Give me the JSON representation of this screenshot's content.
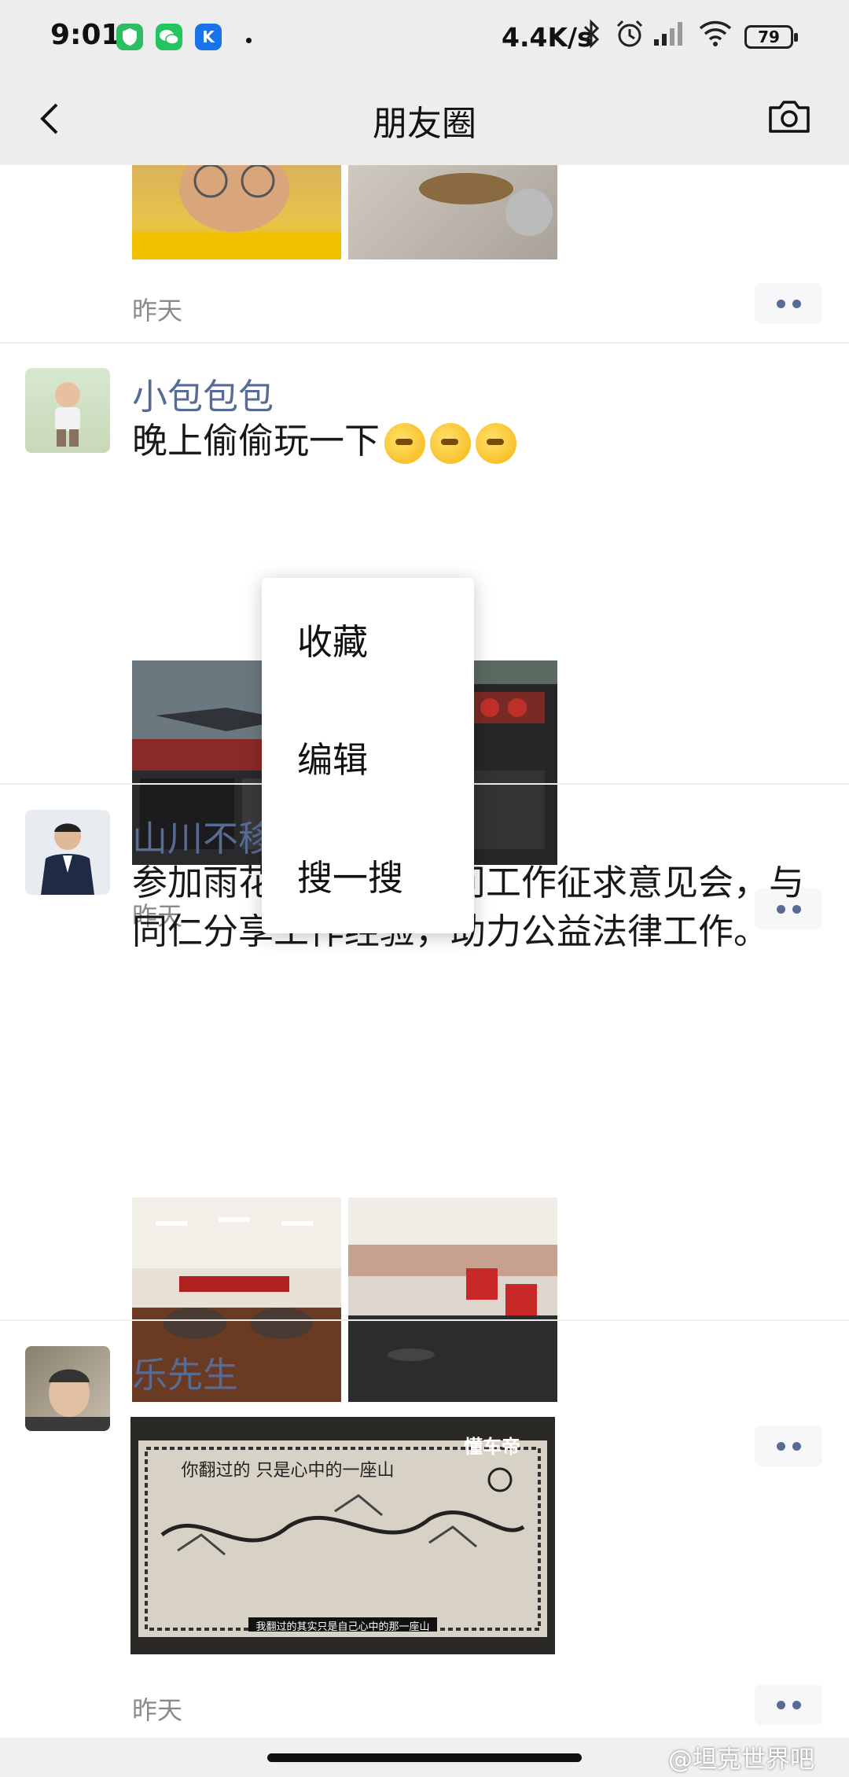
{
  "status_bar": {
    "time": "9:01",
    "app_icons": [
      "shield-app-icon",
      "wechat-icon",
      "k-app-icon"
    ],
    "k_letter": "K",
    "network_speed": "4.4K/s",
    "battery": "79"
  },
  "nav": {
    "title": "朋友圈"
  },
  "posts": [
    {
      "time": "昨天"
    },
    {
      "nickname": "小包包包",
      "content": "晚上偷偷玩一下",
      "emoji_count": 3,
      "time": "昨天"
    },
    {
      "nickname": "山川不移",
      "content": "参加雨花台区法律顾问工作征求意见会，与同仁分享工作经验，助力公益法律工作。",
      "time": "昨天"
    },
    {
      "nickname": "乐先生",
      "time": "昨天",
      "video_brand": "懂车帝",
      "video_map_title": "你翻过的 只是心中的一座山",
      "video_subtitle": "我翻过的其实只是自己心中的那一座山"
    }
  ],
  "context_menu": {
    "items": [
      "收藏",
      "编辑",
      "搜一搜"
    ]
  },
  "watermark": "@坦克世界吧"
}
